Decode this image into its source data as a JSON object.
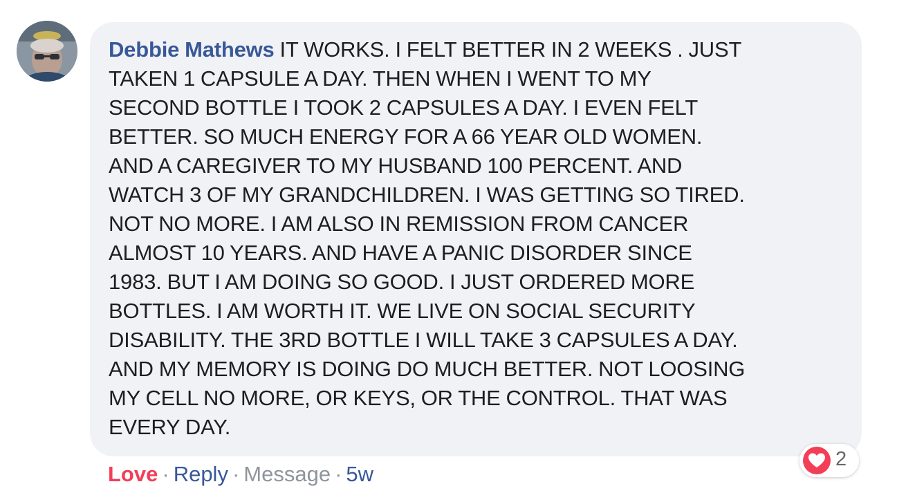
{
  "comment": {
    "author": "Debbie Mathews",
    "text": "IT WORKS. I FELT BETTER IN 2 WEEKS . JUST TAKEN 1 CAPSULE A DAY. THEN WHEN I WENT TO MY SECOND BOTTLE I TOOK 2 CAPSULES A DAY. I EVEN FELT BETTER. SO MUCH ENERGY FOR A 66 YEAR OLD WOMEN. AND A CAREGIVER TO MY HUSBAND 100 PERCENT. AND WATCH 3 OF MY GRANDCHILDREN. I WAS GETTING SO TIRED. NOT NO MORE. I AM ALSO IN REMISSION FROM CANCER ALMOST 10 YEARS. AND HAVE A PANIC DISORDER SINCE 1983. BUT I AM DOING SO GOOD. I JUST ORDERED MORE BOTTLES. I AM WORTH IT. WE LIVE ON SOCIAL SECURITY DISABILITY. THE 3RD BOTTLE I WILL TAKE 3 CAPSULES A DAY. AND MY MEMORY IS DOING DO MUCH BETTER. NOT LOOSING MY CELL NO MORE, OR KEYS, OR THE CONTROL. THAT WAS EVERY DAY.",
    "lines": [
      "IT WORKS. I FELT BETTER IN 2 WEEKS . JUST",
      "TAKEN 1 CAPSULE A DAY. THEN WHEN I WENT TO MY",
      "SECOND BOTTLE I TOOK 2 CAPSULES A DAY. I EVEN FELT",
      "BETTER. SO MUCH ENERGY FOR A 66 YEAR OLD WOMEN.",
      "AND A CAREGIVER TO MY HUSBAND 100 PERCENT. AND",
      "WATCH 3 OF MY GRANDCHILDREN. I WAS GETTING SO TIRED.",
      "NOT NO MORE. I AM ALSO IN REMISSION FROM CANCER",
      "ALMOST 10 YEARS. AND HAVE A PANIC DISORDER SINCE",
      "1983. BUT I AM DOING SO GOOD. I JUST ORDERED MORE",
      "BOTTLES. I AM WORTH IT. WE LIVE ON SOCIAL SECURITY",
      "DISABILITY. THE 3RD BOTTLE I WILL TAKE 3 CAPSULES A DAY.",
      "AND MY MEMORY IS DOING DO MUCH BETTER. NOT LOOSING",
      "MY CELL NO MORE, OR KEYS, OR THE CONTROL. THAT WAS",
      "EVERY DAY."
    ]
  },
  "reactions": {
    "icon": "love-heart-icon",
    "count": "2"
  },
  "actions": {
    "love_label": "Love",
    "reply_label": "Reply",
    "message_label": "Message",
    "separator": "·",
    "timestamp": "5w"
  },
  "colors": {
    "author": "#385898",
    "love": "#f33e58",
    "bubble": "#f1f2f5",
    "muted": "#90949c"
  }
}
